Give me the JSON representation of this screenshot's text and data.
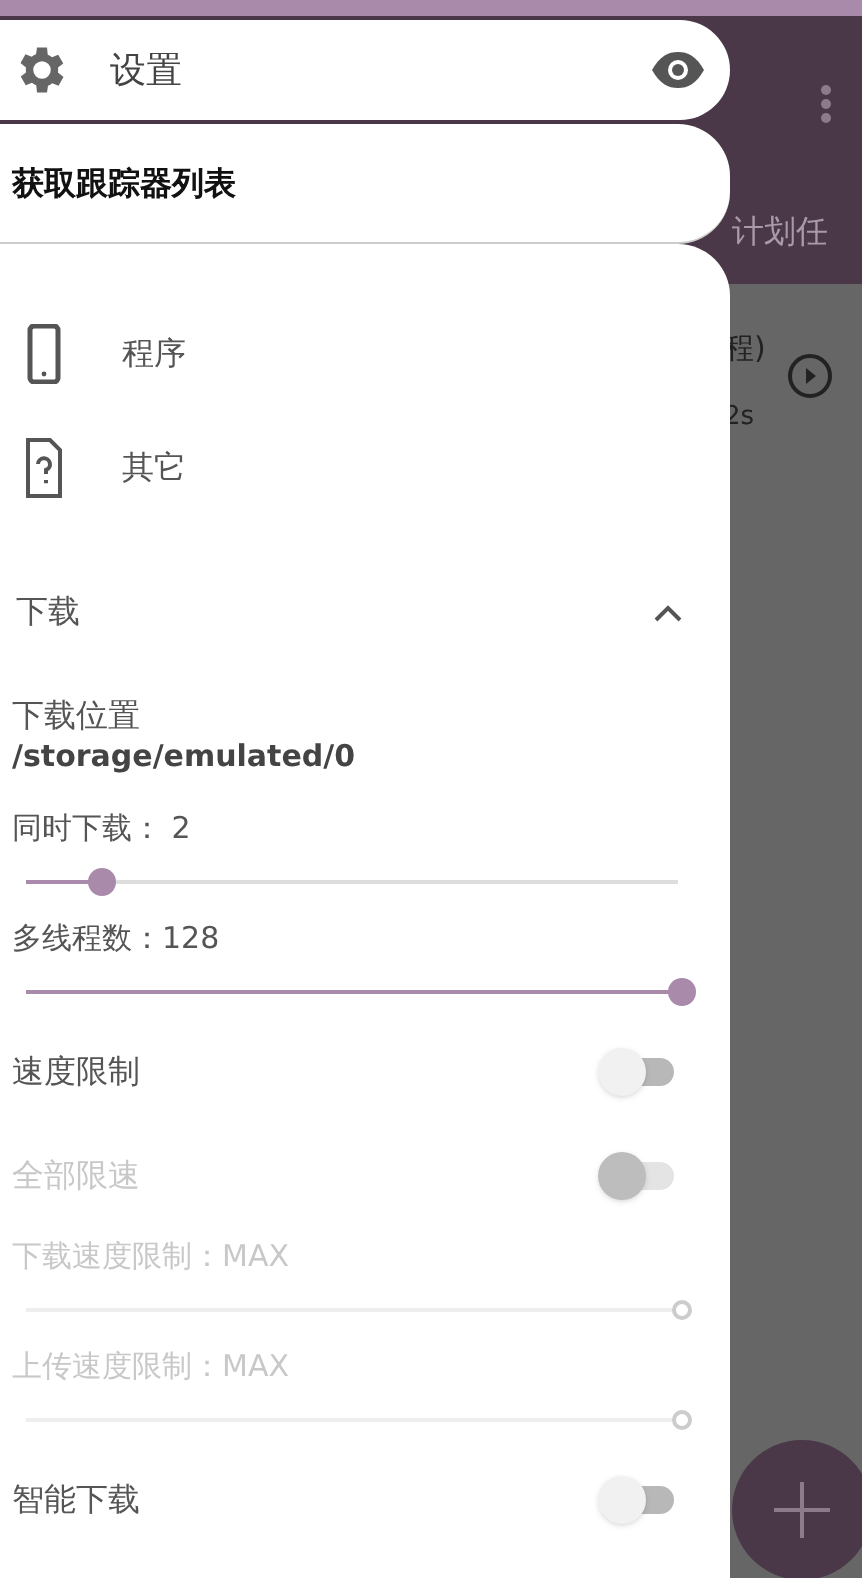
{
  "background": {
    "tab_label": "计划任",
    "task_title": "程)",
    "task_time": "2s"
  },
  "drawer": {
    "title": "设置",
    "tooltip": "获取跟踪器列表",
    "categories": [
      {
        "label": "程序",
        "kind": "phone"
      },
      {
        "label": "其它",
        "kind": "unknown"
      }
    ],
    "section": {
      "title": "下载",
      "expanded": true
    },
    "settings": [
      {
        "kind": "path",
        "label": "下载位置",
        "value": "/storage/emulated/0"
      },
      {
        "kind": "slider",
        "label": "同时下载： 2",
        "level": 0.11,
        "disabled": false
      },
      {
        "kind": "slider",
        "label": "多线程数：128",
        "level": 1,
        "disabled": false
      },
      {
        "kind": "toggle",
        "label": "速度限制",
        "on": false,
        "disabled": false
      },
      {
        "kind": "toggle",
        "label": "全部限速",
        "on": false,
        "disabled": true
      },
      {
        "kind": "slider",
        "label": "下载速度限制：MAX",
        "level": 1,
        "disabled": true
      },
      {
        "kind": "slider",
        "label": "上传速度限制：MAX",
        "level": 1,
        "disabled": true
      },
      {
        "kind": "toggle",
        "label": "智能下载",
        "on": false,
        "disabled": false
      }
    ]
  }
}
